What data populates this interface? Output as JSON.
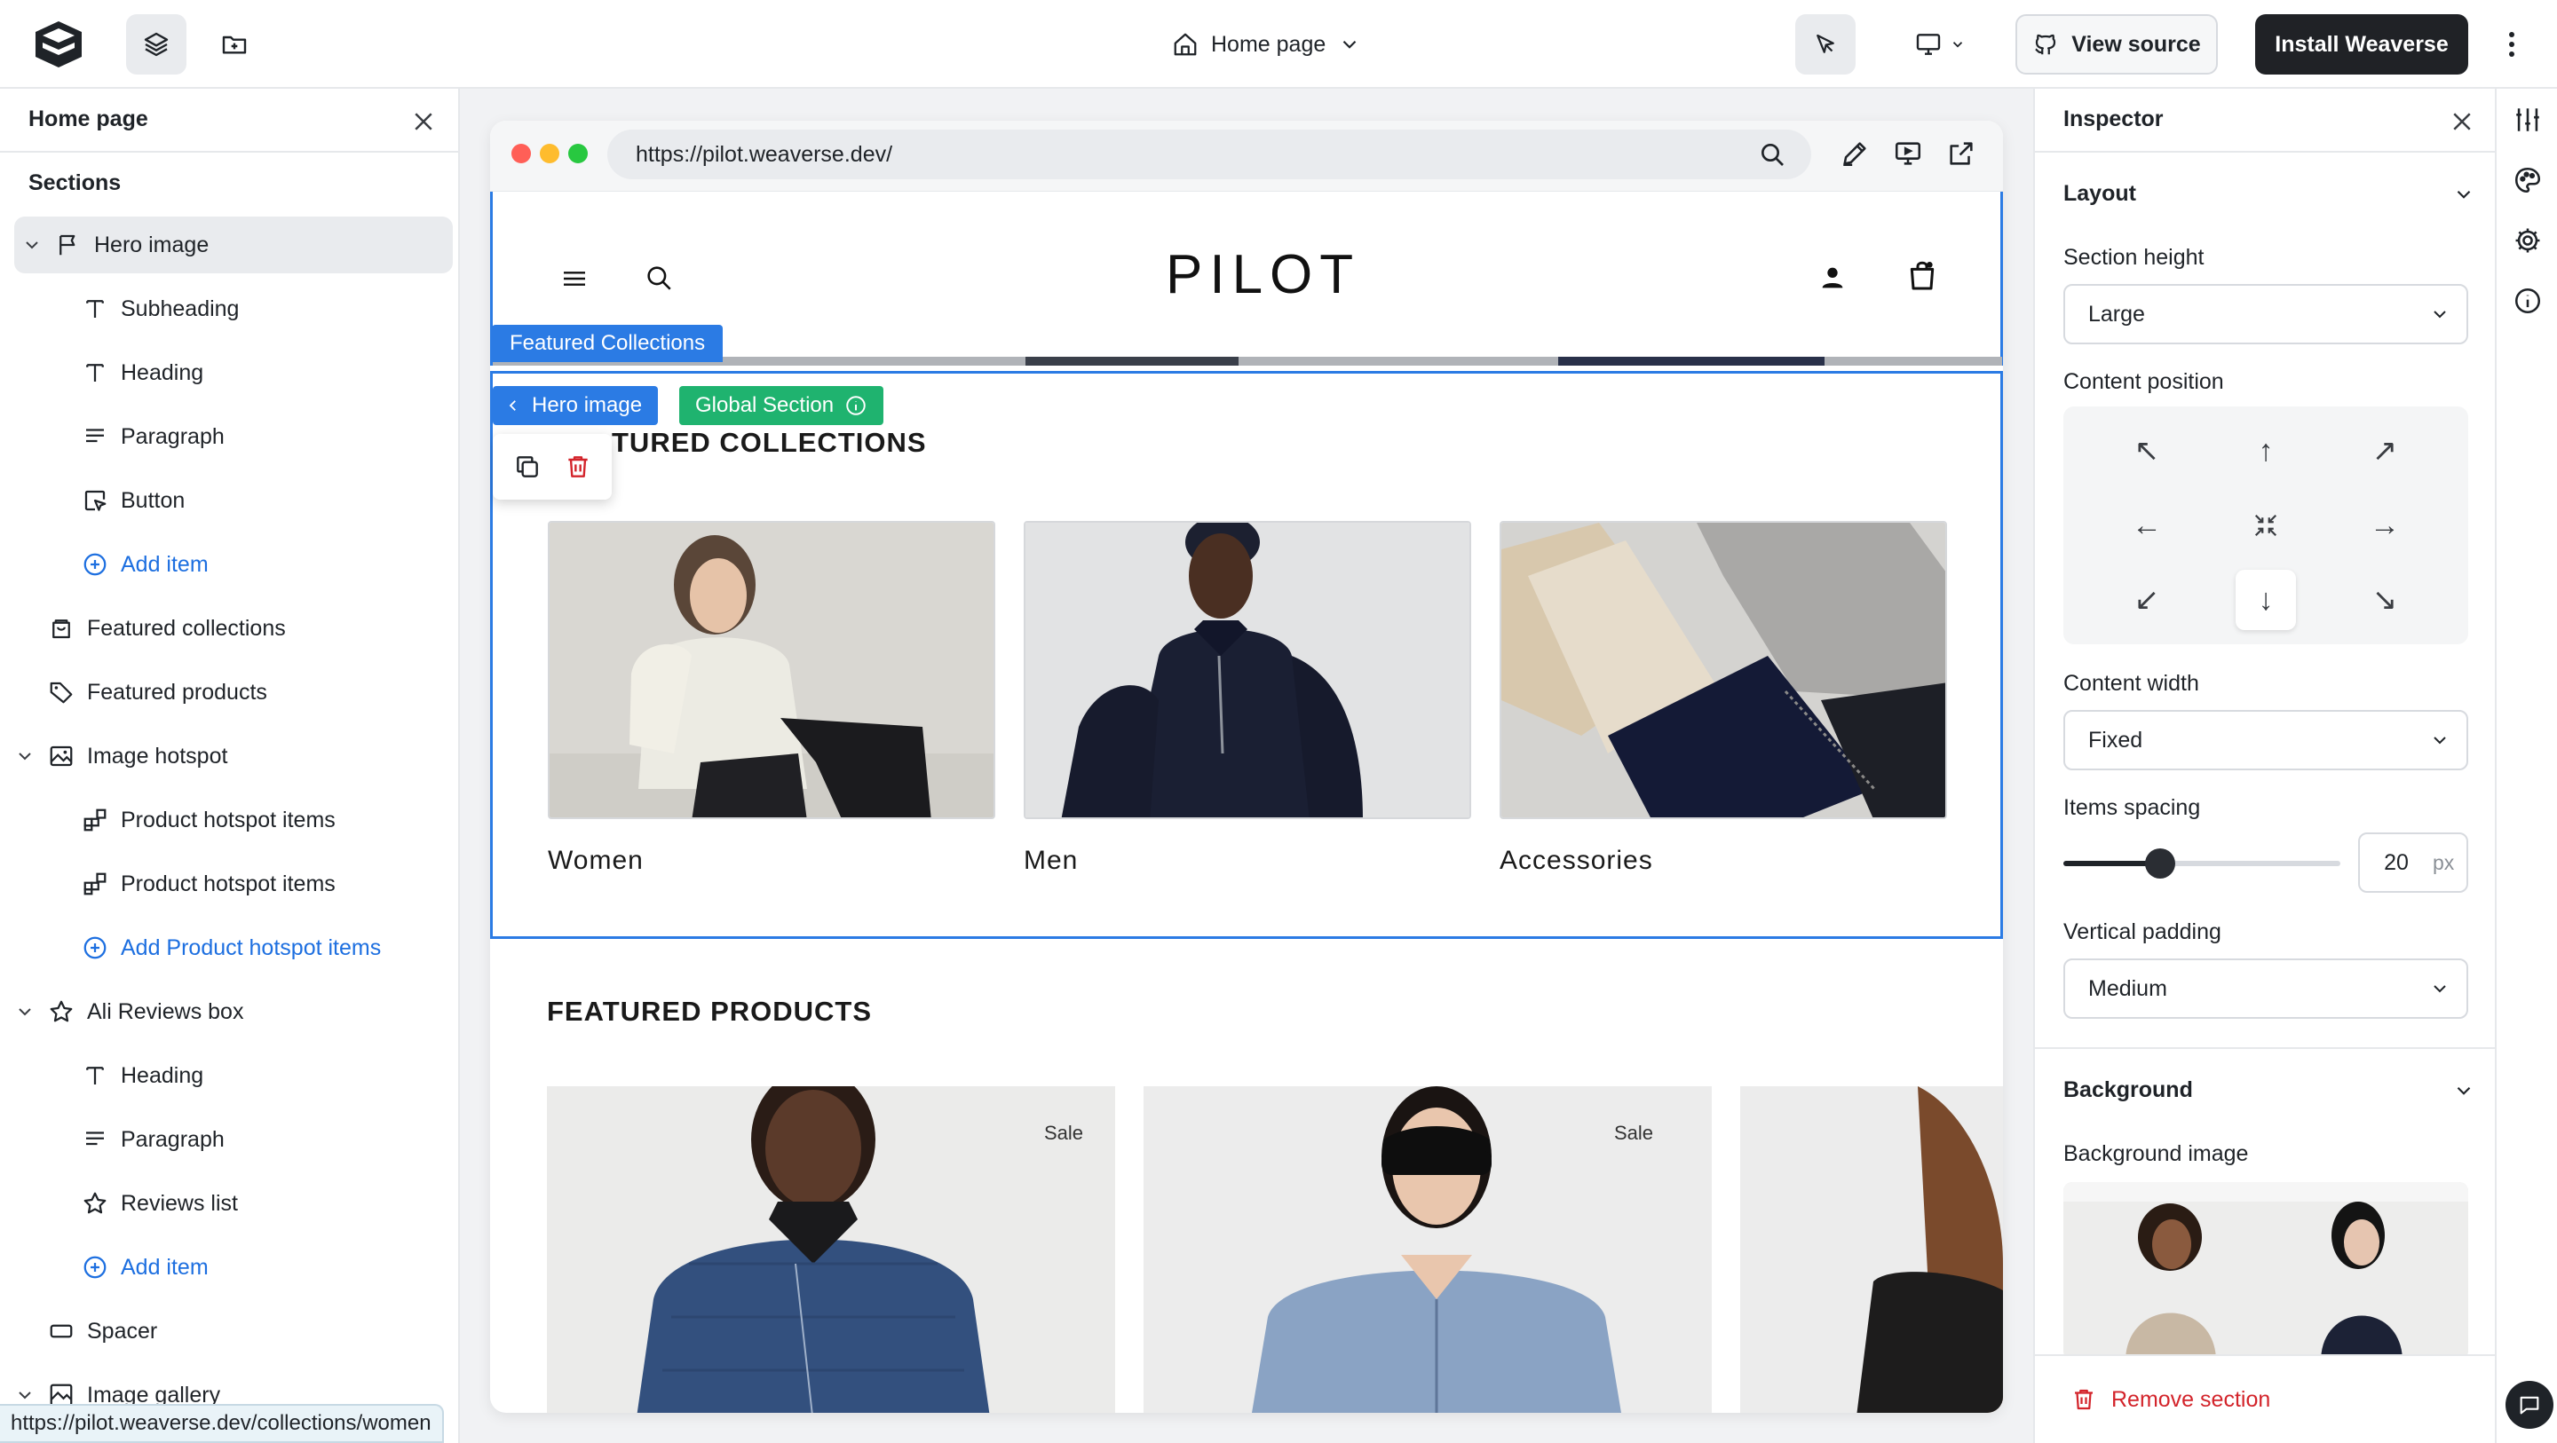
{
  "topbar": {
    "page_select": "Home page",
    "view_source": "View source",
    "install": "Install Weaverse"
  },
  "left_panel": {
    "title": "Home page",
    "sections_label": "Sections",
    "items": [
      {
        "label": "Hero image",
        "icon": "flag-icon",
        "level": 0,
        "expanded": true,
        "selected": true
      },
      {
        "label": "Subheading",
        "icon": "text-icon",
        "level": 1
      },
      {
        "label": "Heading",
        "icon": "text-icon",
        "level": 1
      },
      {
        "label": "Paragraph",
        "icon": "paragraph-icon",
        "level": 1
      },
      {
        "label": "Button",
        "icon": "cursor-click-icon",
        "level": 1
      },
      {
        "label": "Add item",
        "icon": "plus-circle-icon",
        "level": 1,
        "add": true
      },
      {
        "label": "Featured collections",
        "icon": "collection-icon",
        "level": 0
      },
      {
        "label": "Featured products",
        "icon": "tag-icon",
        "level": 0
      },
      {
        "label": "Image hotspot",
        "icon": "image-icon",
        "level": 0,
        "expanded": true
      },
      {
        "label": "Product hotspot items",
        "icon": "blocks-icon",
        "level": 1
      },
      {
        "label": "Product hotspot items",
        "icon": "blocks-icon",
        "level": 1
      },
      {
        "label": "Add Product hotspot items",
        "icon": "plus-circle-icon",
        "level": 1,
        "add": true
      },
      {
        "label": "Ali Reviews box",
        "icon": "star-icon",
        "level": 0,
        "expanded": true
      },
      {
        "label": "Heading",
        "icon": "text-icon",
        "level": 1
      },
      {
        "label": "Paragraph",
        "icon": "paragraph-icon",
        "level": 1
      },
      {
        "label": "Reviews list",
        "icon": "star-icon",
        "level": 1
      },
      {
        "label": "Add item",
        "icon": "plus-circle-icon",
        "level": 1,
        "add": true
      },
      {
        "label": "Spacer",
        "icon": "rectangle-icon",
        "level": 0
      },
      {
        "label": "Image gallery",
        "icon": "gallery-icon",
        "level": 0,
        "expanded": true
      }
    ],
    "status_url": "https://pilot.weaverse.dev/collections/women"
  },
  "canvas": {
    "url": "https://pilot.weaverse.dev/",
    "site_logo": "PILOT",
    "fc_label": "Featured Collections",
    "crumb_hero": "Hero image",
    "crumb_global": "Global Section",
    "fc_title": "FEATURED COLLECTIONS",
    "fc_title_visible": "TURED COLLECTIONS",
    "collections": [
      {
        "name": "Women"
      },
      {
        "name": "Men"
      },
      {
        "name": "Accessories"
      }
    ],
    "fp_title": "FEATURED PRODUCTS",
    "sale_badge": "Sale"
  },
  "inspector": {
    "title": "Inspector",
    "layout_title": "Layout",
    "section_height_label": "Section height",
    "section_height_value": "Large",
    "content_position_label": "Content position",
    "content_position_selected": "bottom-center",
    "content_width_label": "Content width",
    "content_width_value": "Fixed",
    "items_spacing_label": "Items spacing",
    "items_spacing_value": "20",
    "items_spacing_unit": "px",
    "items_spacing_fraction": 0.35,
    "vertical_padding_label": "Vertical padding",
    "vertical_padding_value": "Medium",
    "background_title": "Background",
    "background_image_label": "Background image",
    "remove_section": "Remove section"
  },
  "colors": {
    "accent_blue": "#2b7be4",
    "global_green": "#1fb36f",
    "danger_red": "#d3242b",
    "dark": "#202226"
  }
}
